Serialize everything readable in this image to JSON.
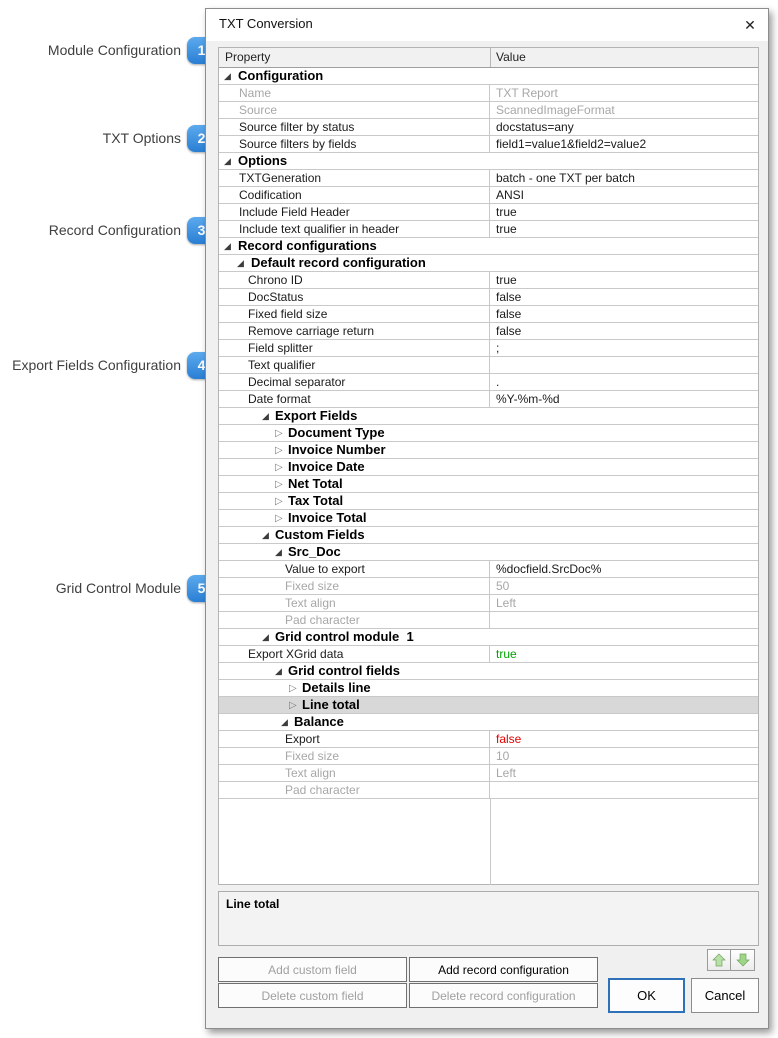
{
  "window": {
    "title": "TXT Conversion"
  },
  "icons": {
    "close": "✕",
    "expanded": "◢",
    "collapsed": "▷",
    "up_arrow": "up-arrow",
    "down_arrow": "down-arrow"
  },
  "colors": {
    "accent_blue": "#2e86dc",
    "ok_focus_border": "#2f71b8",
    "green_value": "#00a000",
    "red_value": "#e80000",
    "selected_row": "#d8d8d8",
    "grid_line": "#c9c9c9",
    "disabled_text": "#a7a7a7",
    "arrow_green_fill": "#b7dfa6",
    "arrow_green_stroke": "#6fa35f"
  },
  "callouts": [
    {
      "num": "1",
      "label": "Module Configuration"
    },
    {
      "num": "2",
      "label": "TXT Options"
    },
    {
      "num": "3",
      "label": "Record Configuration"
    },
    {
      "num": "4",
      "label": "Export Fields Configuration"
    },
    {
      "num": "5",
      "label": "Grid Control Module"
    }
  ],
  "grid": {
    "headers": {
      "property": "Property",
      "value": "Value"
    },
    "rows": [
      {
        "t": "cat",
        "state": "exp",
        "tri": 5,
        "indent": 19,
        "label": "Configuration"
      },
      {
        "t": "prop",
        "indent": 20,
        "label": "Name",
        "value": "TXT Report",
        "disabled": true
      },
      {
        "t": "prop",
        "indent": 20,
        "label": "Source",
        "value": "ScannedImageFormat",
        "disabled": true
      },
      {
        "t": "prop",
        "indent": 20,
        "label": "Source filter by status",
        "value": "docstatus=any"
      },
      {
        "t": "prop",
        "indent": 20,
        "label": "Source filters by fields",
        "value": "field1=value1&field2=value2"
      },
      {
        "t": "cat",
        "state": "exp",
        "tri": 5,
        "indent": 19,
        "label": "Options"
      },
      {
        "t": "prop",
        "indent": 20,
        "label": "TXTGeneration",
        "value": "batch - one TXT per batch"
      },
      {
        "t": "prop",
        "indent": 20,
        "label": "Codification",
        "value": "ANSI"
      },
      {
        "t": "prop",
        "indent": 20,
        "label": "Include Field Header",
        "value": "true"
      },
      {
        "t": "prop",
        "indent": 20,
        "label": "Include text qualifier in header",
        "value": "true"
      },
      {
        "t": "cat",
        "state": "exp",
        "tri": 5,
        "indent": 19,
        "label": "Record configurations"
      },
      {
        "t": "cat",
        "state": "exp",
        "tri": 18,
        "indent": 32,
        "label": "Default record configuration"
      },
      {
        "t": "prop",
        "indent": 29,
        "label": "Chrono ID",
        "value": "true"
      },
      {
        "t": "prop",
        "indent": 29,
        "label": "DocStatus",
        "value": "false"
      },
      {
        "t": "prop",
        "indent": 29,
        "label": "Fixed field size",
        "value": "false"
      },
      {
        "t": "prop",
        "indent": 29,
        "label": "Remove carriage return",
        "value": "false"
      },
      {
        "t": "prop",
        "indent": 29,
        "label": "Field splitter",
        "value": ";"
      },
      {
        "t": "prop",
        "indent": 29,
        "label": "Text qualifier",
        "value": ""
      },
      {
        "t": "prop",
        "indent": 29,
        "label": "Decimal separator",
        "value": "."
      },
      {
        "t": "prop",
        "indent": 29,
        "label": "Date format",
        "value": "%Y-%m-%d"
      },
      {
        "t": "cat",
        "state": "exp",
        "tri": 43,
        "indent": 56,
        "label": "Export Fields"
      },
      {
        "t": "cat",
        "state": "col",
        "tri": 56,
        "indent": 69,
        "label": "Document Type"
      },
      {
        "t": "cat",
        "state": "col",
        "tri": 56,
        "indent": 69,
        "label": "Invoice Number"
      },
      {
        "t": "cat",
        "state": "col",
        "tri": 56,
        "indent": 69,
        "label": "Invoice Date"
      },
      {
        "t": "cat",
        "state": "col",
        "tri": 56,
        "indent": 69,
        "label": "Net Total"
      },
      {
        "t": "cat",
        "state": "col",
        "tri": 56,
        "indent": 69,
        "label": "Tax Total"
      },
      {
        "t": "cat",
        "state": "col",
        "tri": 56,
        "indent": 69,
        "label": "Invoice Total"
      },
      {
        "t": "cat",
        "state": "exp",
        "tri": 43,
        "indent": 56,
        "label": "Custom Fields"
      },
      {
        "t": "cat",
        "state": "exp",
        "tri": 56,
        "indent": 69,
        "label": "Src_Doc"
      },
      {
        "t": "prop",
        "indent": 66,
        "label": "Value to export",
        "value": "%docfield.SrcDoc%"
      },
      {
        "t": "prop",
        "indent": 66,
        "label": "Fixed size",
        "value": "50",
        "disabled": true
      },
      {
        "t": "prop",
        "indent": 66,
        "label": "Text align",
        "value": "Left",
        "disabled": true
      },
      {
        "t": "prop",
        "indent": 66,
        "label": "Pad character",
        "value": "",
        "disabled": true
      },
      {
        "t": "cat",
        "state": "exp",
        "tri": 43,
        "indent": 56,
        "label": "Grid control module  1"
      },
      {
        "t": "prop",
        "indent": 29,
        "label": "Export XGrid data",
        "value": "true",
        "vcolor": "green"
      },
      {
        "t": "cat",
        "state": "exp",
        "tri": 56,
        "indent": 69,
        "label": "Grid control fields"
      },
      {
        "t": "cat",
        "state": "col",
        "tri": 70,
        "indent": 83,
        "label": "Details line"
      },
      {
        "t": "cat",
        "state": "col",
        "tri": 70,
        "indent": 83,
        "label": "Line total",
        "selected": true
      },
      {
        "t": "cat",
        "state": "exp",
        "tri": 62,
        "indent": 75,
        "label": "Balance"
      },
      {
        "t": "prop",
        "indent": 66,
        "label": "Export",
        "value": "false",
        "vcolor": "red"
      },
      {
        "t": "prop",
        "indent": 66,
        "label": "Fixed size",
        "value": "10",
        "disabled": true
      },
      {
        "t": "prop",
        "indent": 66,
        "label": "Text align",
        "value": "Left",
        "disabled": true
      },
      {
        "t": "prop",
        "indent": 66,
        "label": "Pad character",
        "value": "",
        "disabled": true
      }
    ]
  },
  "description": {
    "text": "Line total"
  },
  "buttons": {
    "add_custom_field": "Add custom field",
    "add_record_configuration": "Add record configuration",
    "delete_custom_field": "Delete custom field",
    "delete_record_configuration": "Delete record configuration",
    "ok": "OK",
    "cancel": "Cancel"
  }
}
